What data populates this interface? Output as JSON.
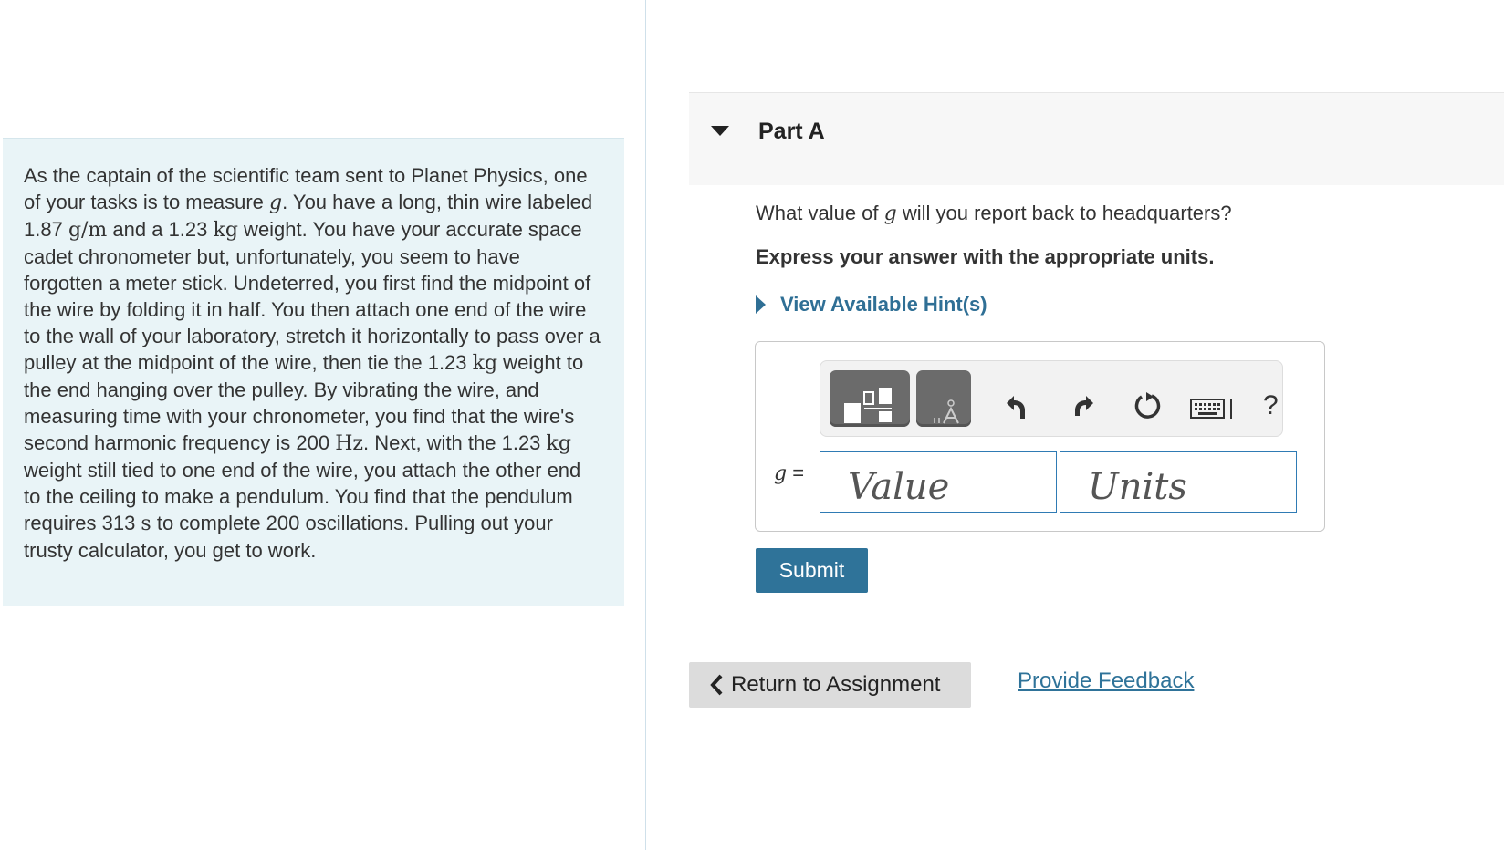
{
  "problem": {
    "t1": "As the captain of the scientific team sent to Planet Physics, one of your tasks is to measure ",
    "g1": "g",
    "t2": ". You have a long, thin wire labeled 1.87 ",
    "u_gm": "g/m",
    "t3": " and a 1.23 ",
    "u_kg1": "kg",
    "t4": " weight. You have your accurate space cadet chronometer but, unfortunately, you seem to have forgotten a meter stick. Undeterred, you first find the midpoint of the wire by folding it in half. You then attach one end of the wire to the wall of your laboratory, stretch it horizontally to pass over a pulley at the midpoint of the wire, then tie the 1.23 ",
    "u_kg2": "kg",
    "t5": " weight to the end hanging over the pulley. By vibrating the wire, and measuring time with your chronometer, you find that the wire's second harmonic frequency is 200 ",
    "u_hz": "Hz",
    "t6": ". Next, with the 1.23 ",
    "u_kg3": "kg",
    "t7": " weight still tied to one end of the wire, you attach the other end to the ceiling to make a pendulum. You find that the pendulum requires 313 ",
    "u_s": "s",
    "t8": " to complete 200 oscillations. Pulling out your trusty calculator, you get to work."
  },
  "part": {
    "title": "Part A",
    "caret_icon": "caret-down-icon"
  },
  "question": {
    "pre": "What value of ",
    "var": "g",
    "post": " will you report back to headquarters?",
    "instruction": "Express your answer with the appropriate units."
  },
  "hints": {
    "label": "View Available Hint(s)",
    "icon": "caret-right-icon"
  },
  "answer": {
    "var": "g",
    "eq": " =",
    "value_placeholder": "Value",
    "units_placeholder": "Units",
    "toolbar": {
      "templates_icon": "templates-icon",
      "symbols_icon": "units-symbols-icon",
      "undo_icon": "undo-icon",
      "redo_icon": "redo-icon",
      "reset_icon": "reset-icon",
      "keyboard_icon": "keyboard-icon",
      "help_label": "?"
    }
  },
  "buttons": {
    "submit": "Submit",
    "return": "Return to Assignment",
    "feedback": "Provide Feedback"
  },
  "colors": {
    "accent": "#2f7399",
    "problem_bg": "#e9f4f7",
    "input_border": "#2f7bb4"
  }
}
